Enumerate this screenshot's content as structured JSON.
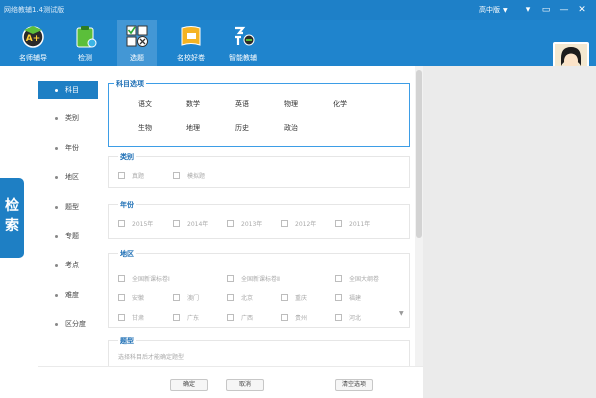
{
  "window": {
    "title": "网络教辅1.4测试版",
    "grade_select": "高中版",
    "controls": [
      "▾",
      "▭",
      "—",
      "✕"
    ]
  },
  "toolbar": {
    "items": [
      {
        "label": "名师辅导",
        "icon": "teacher-badge-icon"
      },
      {
        "label": "检测",
        "icon": "clipboard-icon"
      },
      {
        "label": "选题",
        "icon": "checkbox-grid-icon"
      },
      {
        "label": "名校好卷",
        "icon": "book-scroll-icon"
      },
      {
        "label": "智能教辅",
        "icon": "smart-assist-icon"
      }
    ],
    "avatar": "user-avatar"
  },
  "left_tab": {
    "label_1": "检",
    "label_2": "索"
  },
  "nav": {
    "items": [
      {
        "label": "科目",
        "active": true
      },
      {
        "label": "类别"
      },
      {
        "label": "年份"
      },
      {
        "label": "地区"
      },
      {
        "label": "题型"
      },
      {
        "label": "专题"
      },
      {
        "label": "考点"
      },
      {
        "label": "难度"
      },
      {
        "label": "区分度"
      }
    ]
  },
  "subjects": {
    "title": "科目选项",
    "items": [
      "语文",
      "数学",
      "英语",
      "物理",
      "化学",
      "生物",
      "地理",
      "历史",
      "政治"
    ]
  },
  "category": {
    "title": "类别",
    "options": [
      "真题",
      "模拟题"
    ]
  },
  "year": {
    "title": "年份",
    "options": [
      "2015年",
      "2014年",
      "2013年",
      "2012年",
      "2011年"
    ]
  },
  "region": {
    "title": "地区",
    "options": [
      "全国新课标卷Ⅰ",
      "全国新课标卷Ⅱ",
      "全国大纲卷",
      "安徽",
      "澳门",
      "北京",
      "重庆",
      "福建",
      "甘肃",
      "广东",
      "广西",
      "贵州",
      "河北"
    ]
  },
  "question_type": {
    "title": "题型",
    "hint": "选择科目后才能确定题型"
  },
  "buttons": {
    "confirm": "确定",
    "cancel": "取消",
    "clear": "清空选项"
  }
}
